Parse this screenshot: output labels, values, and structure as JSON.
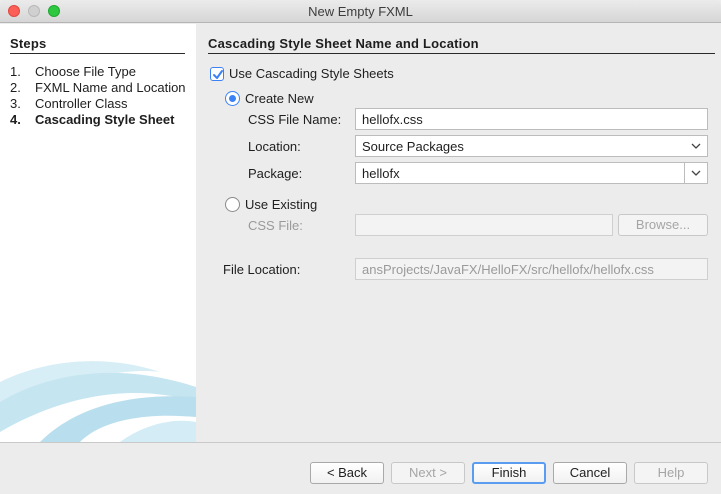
{
  "window": {
    "title": "New Empty FXML"
  },
  "steps": {
    "heading": "Steps",
    "items": [
      {
        "num": "1.",
        "label": "Choose File Type"
      },
      {
        "num": "2.",
        "label": "FXML Name and Location"
      },
      {
        "num": "3.",
        "label": "Controller Class"
      },
      {
        "num": "4.",
        "label": "Cascading Style Sheet"
      }
    ],
    "current_index": 3
  },
  "main": {
    "heading": "Cascading Style Sheet Name and Location",
    "use_css": {
      "label": "Use Cascading Style Sheets",
      "checked": true
    },
    "create_new": {
      "label": "Create New",
      "selected": true,
      "css_file_name_label": "CSS File Name:",
      "css_file_name_value": "hellofx.css",
      "location_label": "Location:",
      "location_value": "Source Packages",
      "package_label": "Package:",
      "package_value": "hellofx"
    },
    "use_existing": {
      "label": "Use Existing",
      "selected": false,
      "css_file_label": "CSS File:",
      "css_file_value": "",
      "browse_label": "Browse..."
    },
    "file_location": {
      "label": "File Location:",
      "value": "ansProjects/JavaFX/HelloFX/src/hellofx/hellofx.css"
    }
  },
  "footer": {
    "back_label": "< Back",
    "next_label": "Next >",
    "finish_label": "Finish",
    "cancel_label": "Cancel",
    "help_label": "Help"
  },
  "colors": {
    "accent": "#3b82f6",
    "swoosh": "#bfe3f0"
  }
}
